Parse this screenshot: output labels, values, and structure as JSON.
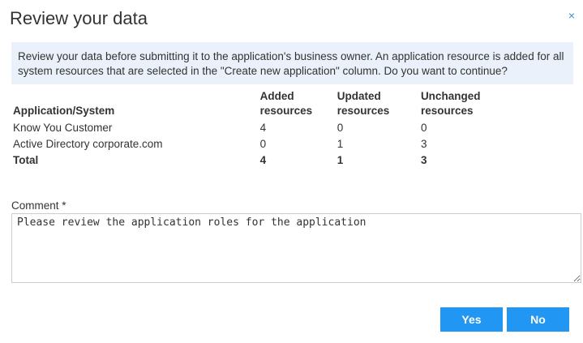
{
  "dialog": {
    "title": "Review your data",
    "close_icon": "×",
    "info_text": "Review your data before submitting it to the application's business owner. An application resource is added for all system resources that are selected in the \"Create new application\" column. Do you want to continue?"
  },
  "table": {
    "headers": [
      "Application/System",
      "Added resources",
      "Updated resources",
      "Unchanged resources"
    ],
    "rows": [
      [
        "Know You Customer",
        "4",
        "0",
        "0"
      ],
      [
        "Active Directory corporate.com",
        "0",
        "1",
        "3"
      ]
    ],
    "total": [
      "Total",
      "4",
      "1",
      "3"
    ]
  },
  "comment": {
    "label": "Comment *",
    "value": "Please review the application roles for the application"
  },
  "buttons": {
    "yes": "Yes",
    "no": "No"
  },
  "colors": {
    "accent": "#2196f3",
    "info_background": "#eaf1fa"
  }
}
